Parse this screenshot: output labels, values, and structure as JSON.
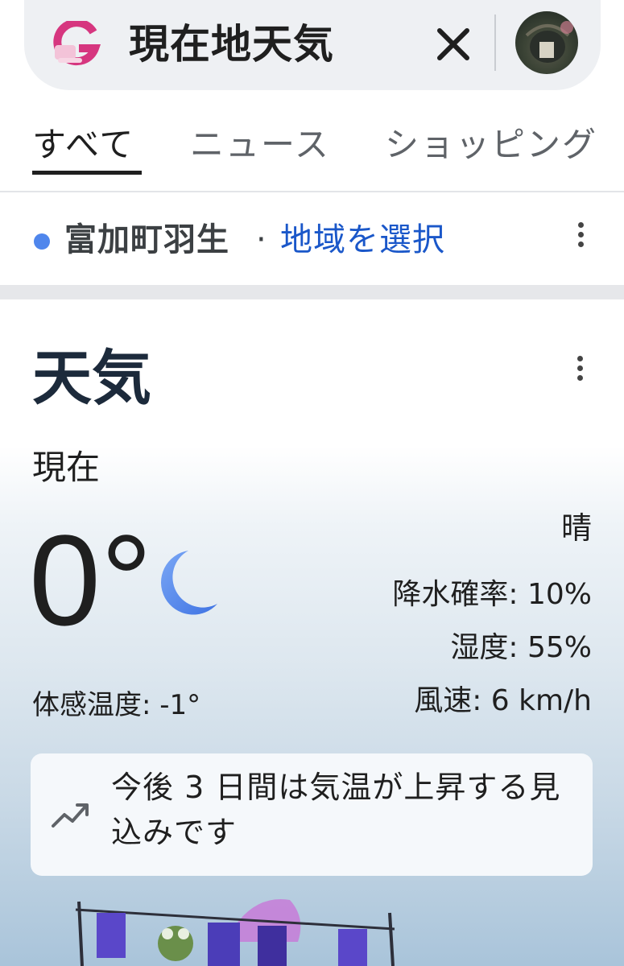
{
  "search": {
    "query": "現在地天気"
  },
  "tabs": [
    {
      "label": "すべて",
      "active": true
    },
    {
      "label": "ニュース",
      "active": false
    },
    {
      "label": "ショッピング",
      "active": false
    }
  ],
  "location": {
    "name": "富加町羽生",
    "separator": "·",
    "link": "地域を選択"
  },
  "weather": {
    "title": "天気",
    "now_label": "現在",
    "temperature": "0°",
    "condition": "晴",
    "icon": "moon-icon",
    "feels_like": "体感温度: -1°",
    "precipitation": "降水確率: 10%",
    "humidity": "湿度: 55%",
    "wind": "風速: 6 km/h",
    "trend_text": "今後 3 日間は気温が上昇する見込みです"
  },
  "colors": {
    "accent_blue": "#1a57c9",
    "location_dot": "#4f86ec",
    "moon": "#5b8def"
  }
}
